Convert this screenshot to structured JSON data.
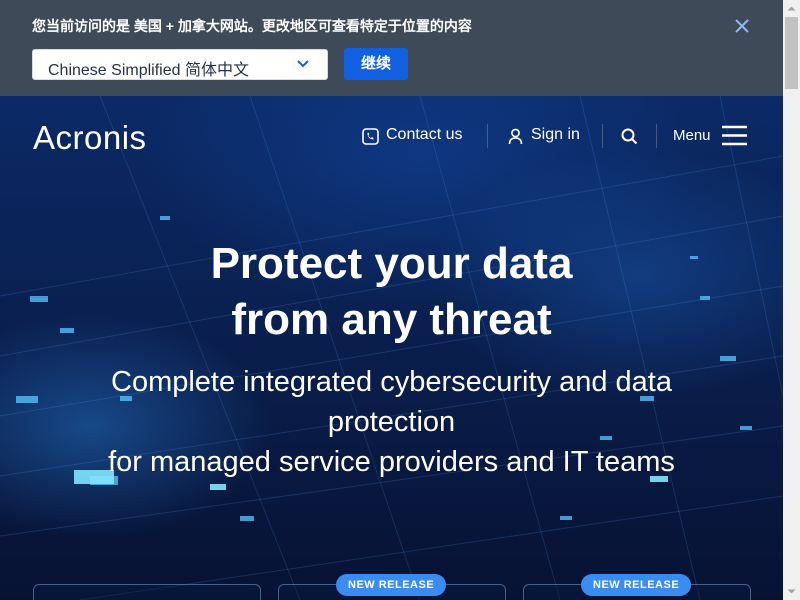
{
  "locale_banner": {
    "message": "您当前访问的是 美国 + 加拿大网站。更改地区可查看特定于位置的内容",
    "language_select": {
      "value": "Chinese Simplified  简体中文"
    },
    "continue_label": "继续"
  },
  "header": {
    "logo": "Acronis",
    "contact_label": "Contact us",
    "signin_label": "Sign in",
    "menu_label": "Menu"
  },
  "hero": {
    "title_line1": "Protect your data",
    "title_line2": "from any threat",
    "subtitle_line1": "Complete integrated cybersecurity and data",
    "subtitle_line2": "protection",
    "subtitle_line3": "for managed service providers and IT teams"
  },
  "cards": {
    "badge_1": "NEW RELEASE",
    "badge_2": "NEW RELEASE"
  },
  "colors": {
    "banner_bg": "#3f4a59",
    "accent_blue": "#1060e0",
    "badge_blue": "#3a8cf0",
    "hero_dark": "#0b1f4a"
  }
}
